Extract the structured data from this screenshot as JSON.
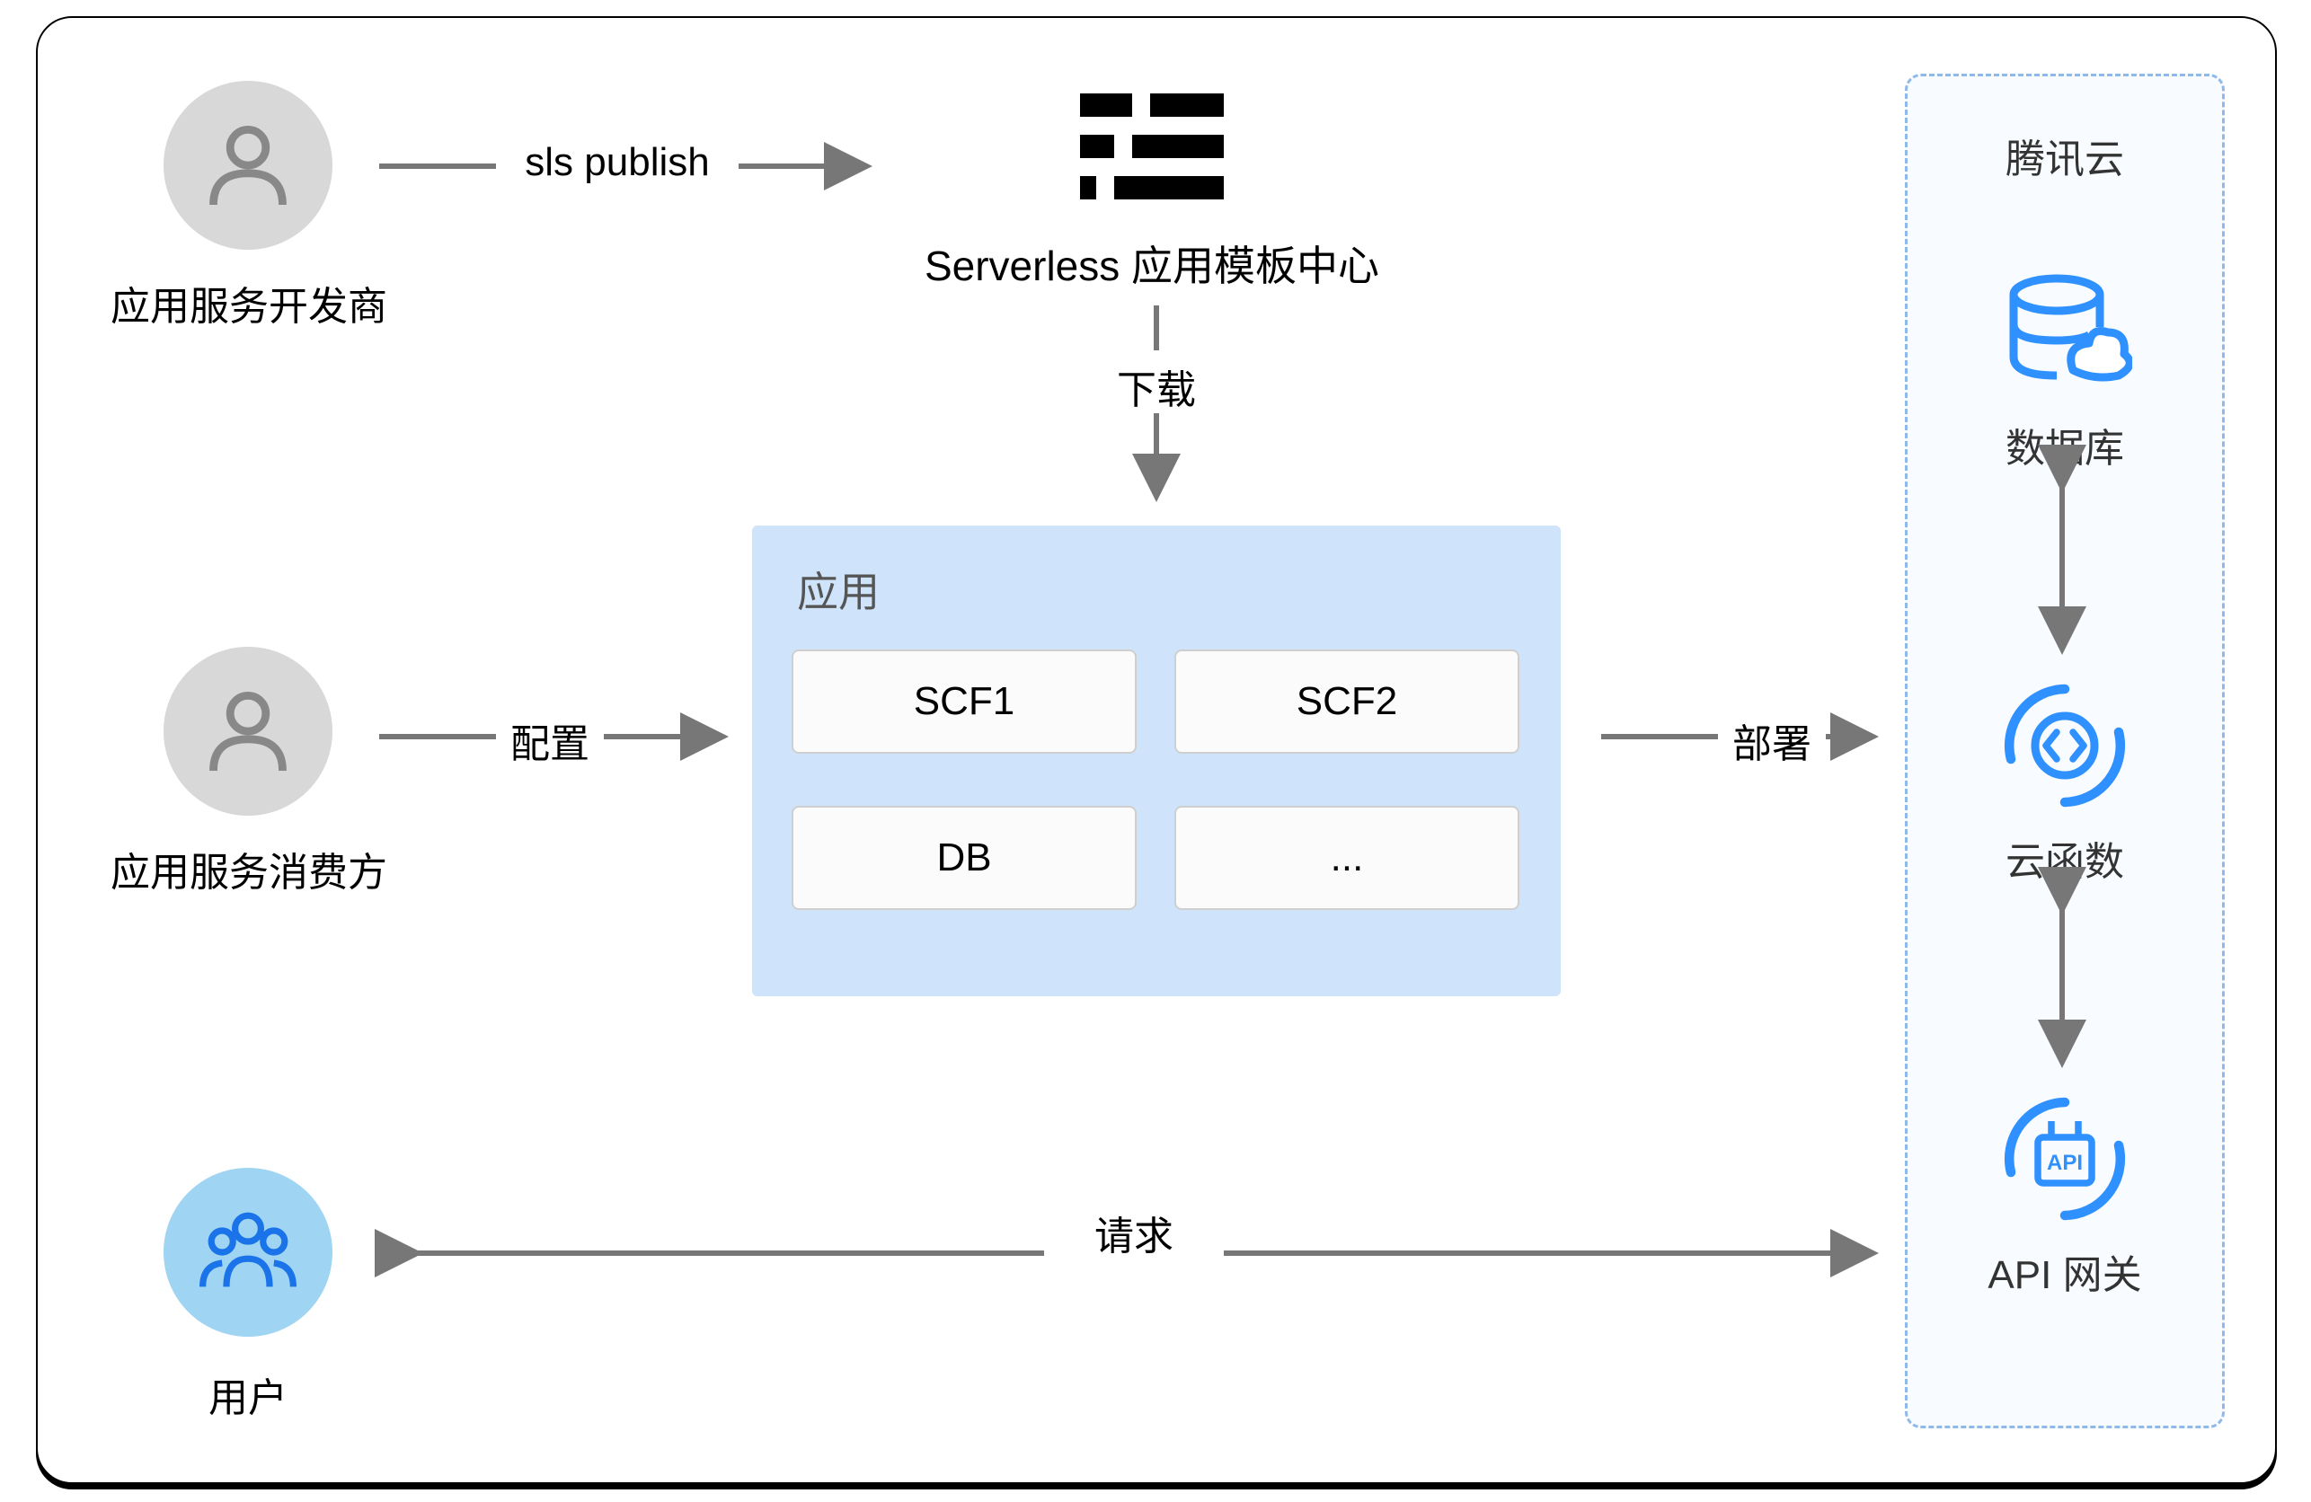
{
  "actors": {
    "developer": "应用服务开发商",
    "consumer": "应用服务消费方",
    "user": "用户"
  },
  "center": {
    "serverless_label": "Serverless 应用模板中心",
    "app_title": "应用",
    "cells": {
      "scf1": "SCF1",
      "scf2": "SCF2",
      "db": "DB",
      "more": "..."
    }
  },
  "arrows": {
    "publish": "sls publish",
    "download": "下载",
    "configure": "配置",
    "deploy": "部署",
    "request": "请求"
  },
  "cloud": {
    "title": "腾讯云",
    "db": "数据库",
    "func": "云函数",
    "api": "API 网关"
  }
}
